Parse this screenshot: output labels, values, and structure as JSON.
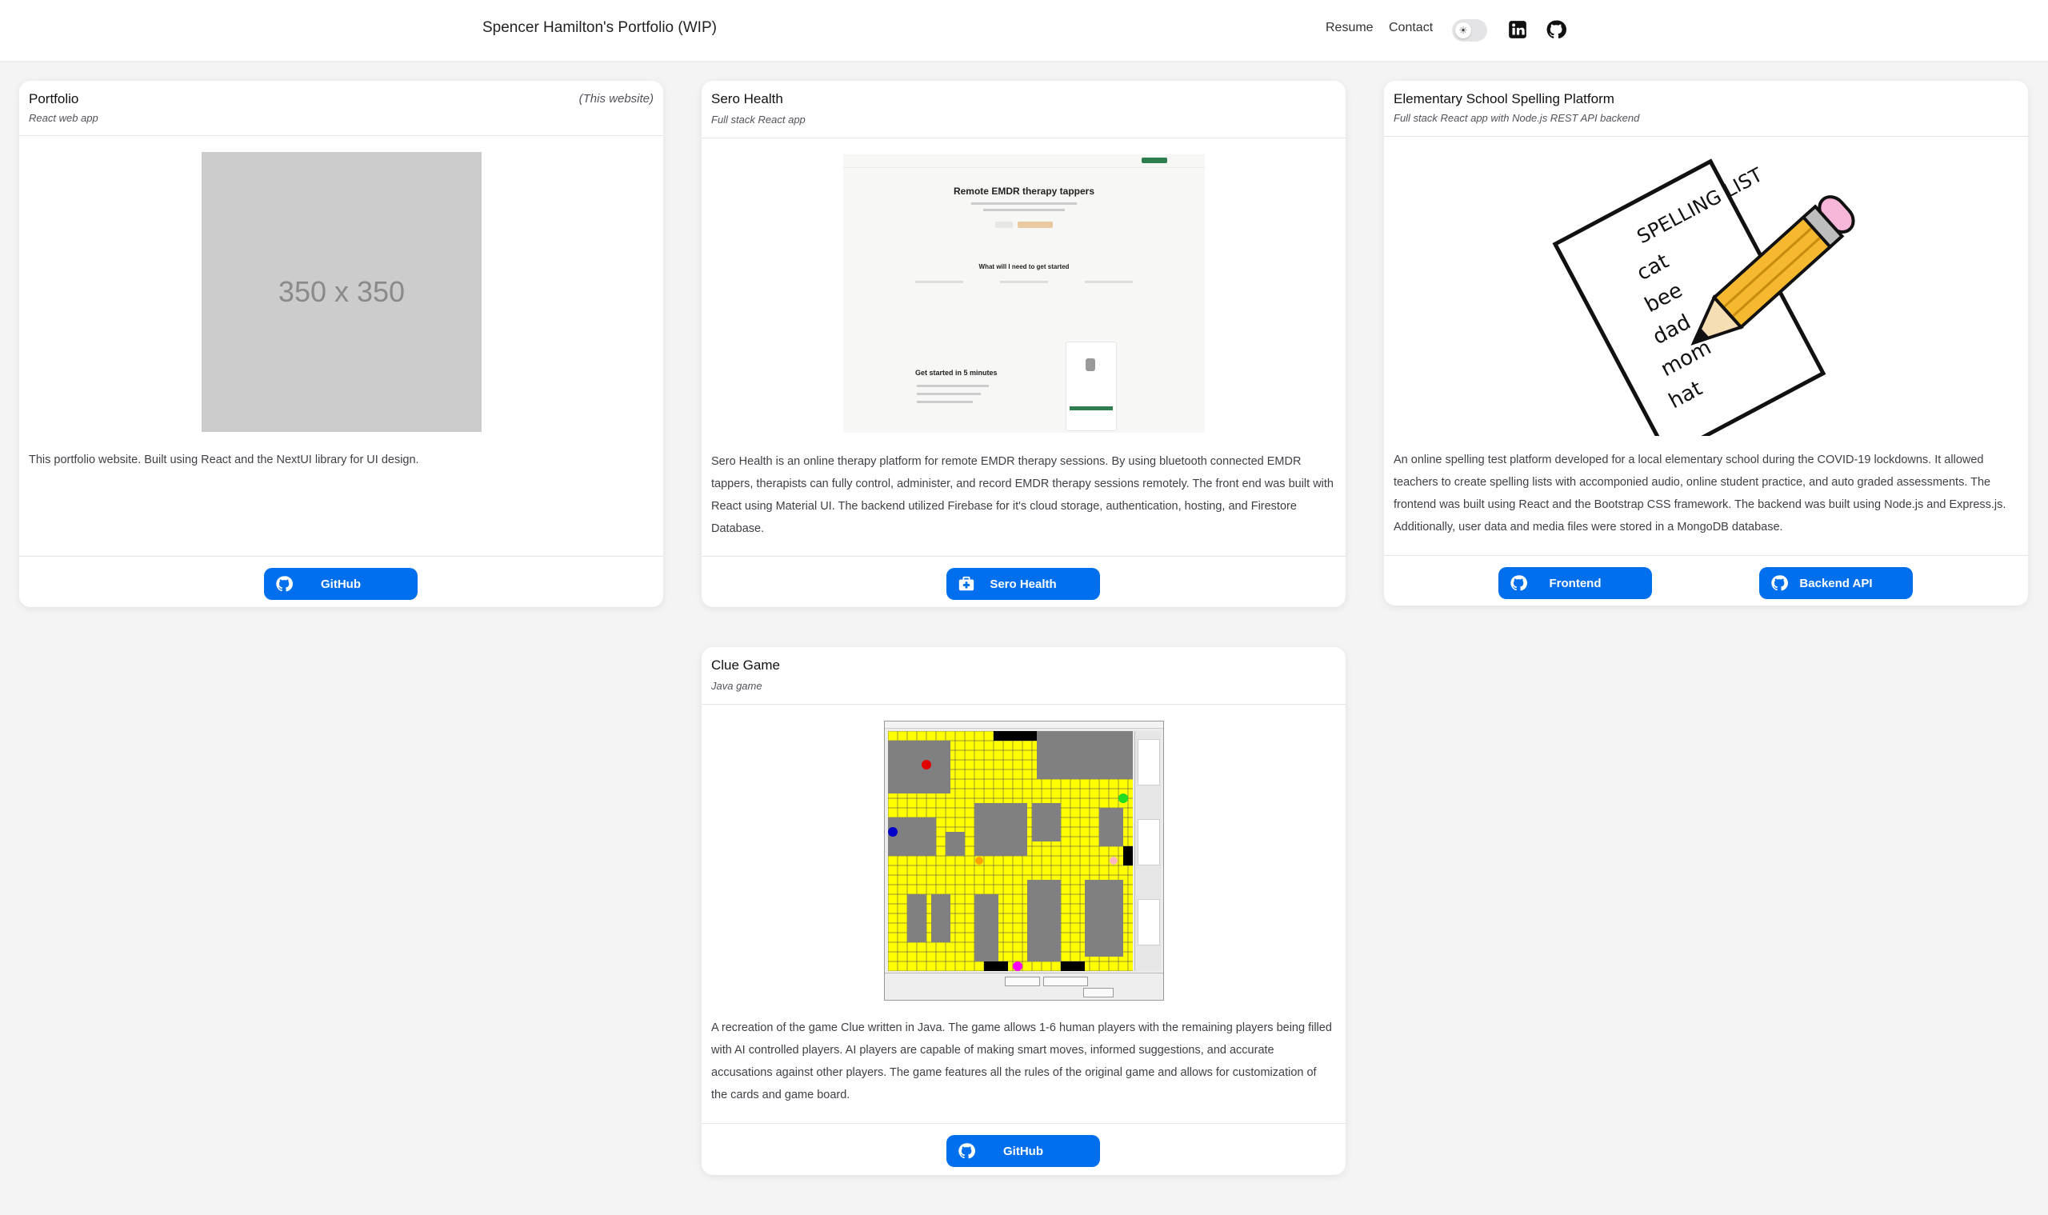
{
  "nav": {
    "brand": "Spencer Hamilton's Portfolio (WIP)",
    "links": [
      "Resume",
      "Contact"
    ],
    "theme_toggle_icon": "sun-icon",
    "icons": [
      "linkedin-icon",
      "github-icon"
    ]
  },
  "cards": [
    {
      "title": "Portfolio",
      "subtitle": "React web app",
      "aside": "(This website)",
      "image_text": "350 x 350",
      "description": "This portfolio website. Built using React and the NextUI library for UI design.",
      "buttons": [
        {
          "label": "GitHub",
          "icon": "github-icon"
        }
      ]
    },
    {
      "title": "Sero Health",
      "subtitle": "Full stack React app",
      "image": {
        "heading": "Remote EMDR therapy tappers",
        "section": "What will I need to get started",
        "cta": "Get started in 5 minutes"
      },
      "description": "Sero Health is an online therapy platform for remote EMDR therapy sessions. By using bluetooth connected EMDR tappers, therapists can fully control, administer, and record EMDR therapy sessions remotely. The front end was built with React using Material UI. The backend utilized Firebase for it's cloud storage, authentication, hosting, and Firestore Database.",
      "buttons": [
        {
          "label": "Sero Health",
          "icon": "medical-kit-icon"
        }
      ]
    },
    {
      "title": "Elementary School Spelling Platform",
      "subtitle": "Full stack React app with Node.js REST API backend",
      "image": {
        "heading": "SPELLING LIST",
        "words": [
          "cat",
          "bee",
          "dad",
          "mom",
          "hat"
        ]
      },
      "description": "An online spelling test platform developed for a local elementary school during the COVID-19 lockdowns. It allowed teachers to create spelling lists with accomponied audio, online student practice, and auto graded assessments. The frontend was built using React and the Bootstrap CSS framework. The backend was built using Node.js and Express.js. Additionally, user data and media files were stored in a MongoDB database.",
      "buttons": [
        {
          "label": "Frontend",
          "icon": "github-icon"
        },
        {
          "label": "Backend API",
          "icon": "github-icon"
        }
      ]
    },
    {
      "title": "Clue Game",
      "subtitle": "Java game",
      "description": "A recreation of the game Clue written in Java. The game allows 1-6 human players with the remaining players being filled with AI controlled players. AI players are capable of making smart moves, informed suggestions, and accurate accusations against other players. The game features all the rules of the original game and allows for customization of the cards and game board.",
      "buttons": [
        {
          "label": "GitHub",
          "icon": "github-icon"
        }
      ]
    }
  ],
  "colors": {
    "button": "#006fee",
    "background": "#f4f4f5",
    "board_yellow": "#ffff00",
    "room_gray": "#808080"
  }
}
